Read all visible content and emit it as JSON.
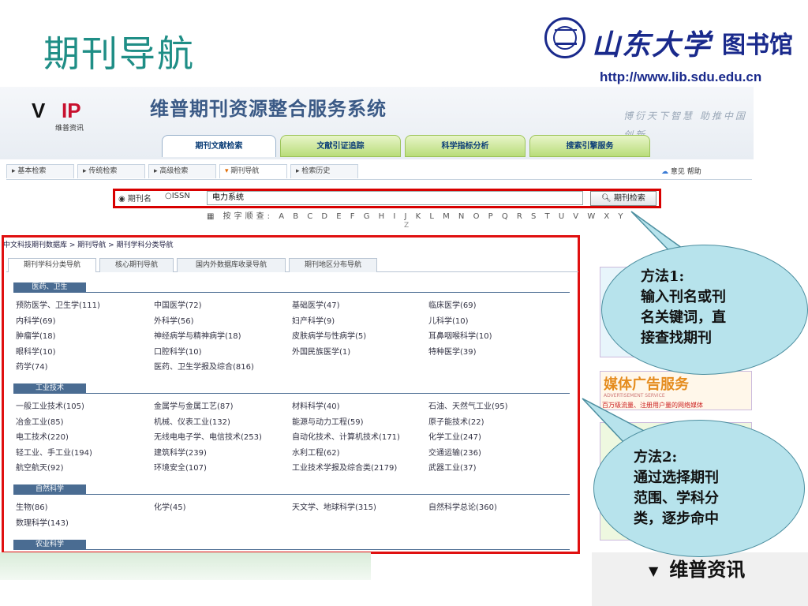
{
  "slide": {
    "title": "期刊导航",
    "logo_calligraphy": "山东大学",
    "logo_library": "图书馆",
    "logo_url": "http://www.lib.sdu.edu.cn"
  },
  "app": {
    "brand_sub": "维普资讯",
    "system_title": "维普期刊资源整合服务系统",
    "slogan": "博衍天下智慧 助推中国创新",
    "main_tabs": [
      "期刊文献检索",
      "文献引证追踪",
      "科学指标分析",
      "搜索引擎服务"
    ],
    "sub_tabs": [
      "基本检索",
      "传统检索",
      "高级检索",
      "期刊导航",
      "检索历史"
    ],
    "help_links": "意见  帮助",
    "search": {
      "radio_name": "期刊名",
      "radio_issn": "ISSN",
      "value": "电力系统",
      "button": "期刊检索",
      "alpha_label": "按字顺查:",
      "alpha_letters": "A B C D E F G H I J K L M N O P Q R S T U V W X Y",
      "alpha_last": "Z"
    },
    "breadcrumb": "中文科技期刊数据库 > 期刊导航 > 期刊学科分类导航",
    "category_tabs": [
      "期刊学科分类导航",
      "核心期刊导航",
      "国内外数据库收录导航",
      "期刊地区分布导航"
    ],
    "sections": [
      {
        "title": "医药、卫生",
        "items": [
          "预防医学、卫生学(111)",
          "中国医学(72)",
          "基础医学(47)",
          "临床医学(69)",
          "内科学(69)",
          "外科学(56)",
          "妇产科学(9)",
          "儿科学(10)",
          "肿瘤学(18)",
          "神经病学与精神病学(18)",
          "皮肤病学与性病学(5)",
          "耳鼻咽喉科学(10)",
          "眼科学(10)",
          "口腔科学(10)",
          "外国民族医学(1)",
          "特种医学(39)",
          "药学(74)",
          "医药、卫生学报及综合(816)"
        ]
      },
      {
        "title": "工业技术",
        "items": [
          "一般工业技术(105)",
          "金属学与金属工艺(87)",
          "材料科学(40)",
          "石油、天然气工业(95)",
          "冶金工业(85)",
          "机械、仪表工业(132)",
          "能源与动力工程(59)",
          "原子能技术(22)",
          "电工技术(220)",
          "无线电电子学、电信技术(253)",
          "自动化技术、计算机技术(171)",
          "化学工业(247)",
          "轻工业、手工业(194)",
          "建筑科学(239)",
          "水利工程(62)",
          "交通运输(236)",
          "航空航天(92)",
          "环境安全(107)",
          "工业技术学报及综合类(2179)",
          "武器工业(37)"
        ]
      },
      {
        "title": "自然科学",
        "items": [
          "生物(86)",
          "化学(45)",
          "天文学、地球科学(315)",
          "自然科学总论(360)",
          "数理科学(143)"
        ]
      },
      {
        "title": "农业科学",
        "items": []
      }
    ],
    "media_ad": {
      "title": "媒体广告服务",
      "sub": "ADVERTISEMENT SERVICE",
      "line": "百万级流量、注册用户量的网络媒体"
    },
    "footer_brand": "维普资讯"
  },
  "callouts": [
    {
      "lines": [
        "方法1:",
        "输入刊名或刊",
        "名关键词，直",
        "接查找期刊"
      ]
    },
    {
      "lines": [
        "方法2:",
        "通过选择期刊",
        "范围、学科分",
        "类，逐步命中"
      ]
    }
  ],
  "colors": {
    "title": "#1f8e86",
    "highlight_border": "#e01010",
    "bubble_fill": "#b7e3ec",
    "section_header": "#4a6c92"
  }
}
